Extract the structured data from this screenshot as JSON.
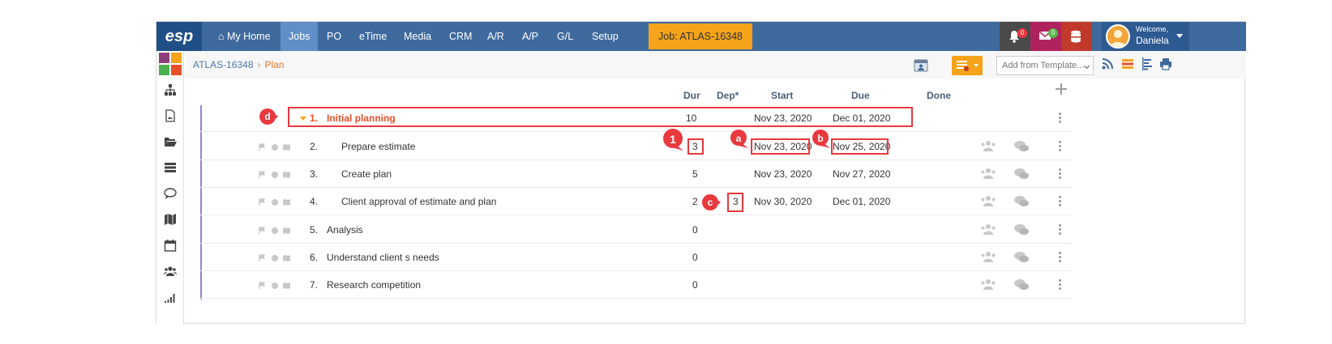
{
  "app": {
    "logo": "esp",
    "nav": [
      {
        "label": "My Home",
        "icon": "home-icon"
      },
      {
        "label": "Jobs",
        "active": true
      },
      {
        "label": "PO"
      },
      {
        "label": "eTime"
      },
      {
        "label": "Media"
      },
      {
        "label": "CRM"
      },
      {
        "label": "A/R"
      },
      {
        "label": "A/P"
      },
      {
        "label": "G/L"
      },
      {
        "label": "Setup"
      }
    ],
    "job_button": "Job: ATLAS-16348",
    "notifications": {
      "bell_count": "0",
      "mail_count": "0"
    },
    "welcome_label": "Welcome,",
    "user_name": "Daniela",
    "colors": {
      "nav": "#3e6a9e",
      "accent": "#f5a31a",
      "summary": "#e8502a",
      "annotation": "#e8393f"
    }
  },
  "breadcrumb": {
    "job": "ATLAS-16348",
    "page": "Plan"
  },
  "toolbar": {
    "template_placeholder": "Add from Template..."
  },
  "columns": {
    "dur": "Dur",
    "dep": "Dep*",
    "start": "Start",
    "due": "Due",
    "done": "Done"
  },
  "tasks": [
    {
      "num": "1.",
      "title": "Initial planning",
      "dur": "10",
      "dep": "",
      "start": "Nov 23, 2020",
      "due": "Dec 01, 2020",
      "summary": true
    },
    {
      "num": "2.",
      "title": "Prepare estimate",
      "dur": "3",
      "dep": "",
      "start": "Nov 23, 2020",
      "due": "Nov 25, 2020"
    },
    {
      "num": "3.",
      "title": "Create plan",
      "dur": "5",
      "dep": "",
      "start": "Nov 23, 2020",
      "due": "Nov 27, 2020"
    },
    {
      "num": "4.",
      "title": "Client approval of estimate and plan",
      "dur": "2",
      "dep": "3",
      "start": "Nov 30, 2020",
      "due": "Dec 01, 2020"
    },
    {
      "num": "5.",
      "title": "Analysis",
      "dur": "0",
      "dep": "",
      "start": "",
      "due": ""
    },
    {
      "num": "6.",
      "title": "Understand client s needs",
      "dur": "0",
      "dep": "",
      "start": "",
      "due": ""
    },
    {
      "num": "7.",
      "title": "Research competition",
      "dur": "0",
      "dep": "",
      "start": "",
      "due": ""
    }
  ],
  "annotations": {
    "d": "d",
    "one": "1",
    "a": "a",
    "b": "b",
    "c": "c"
  }
}
